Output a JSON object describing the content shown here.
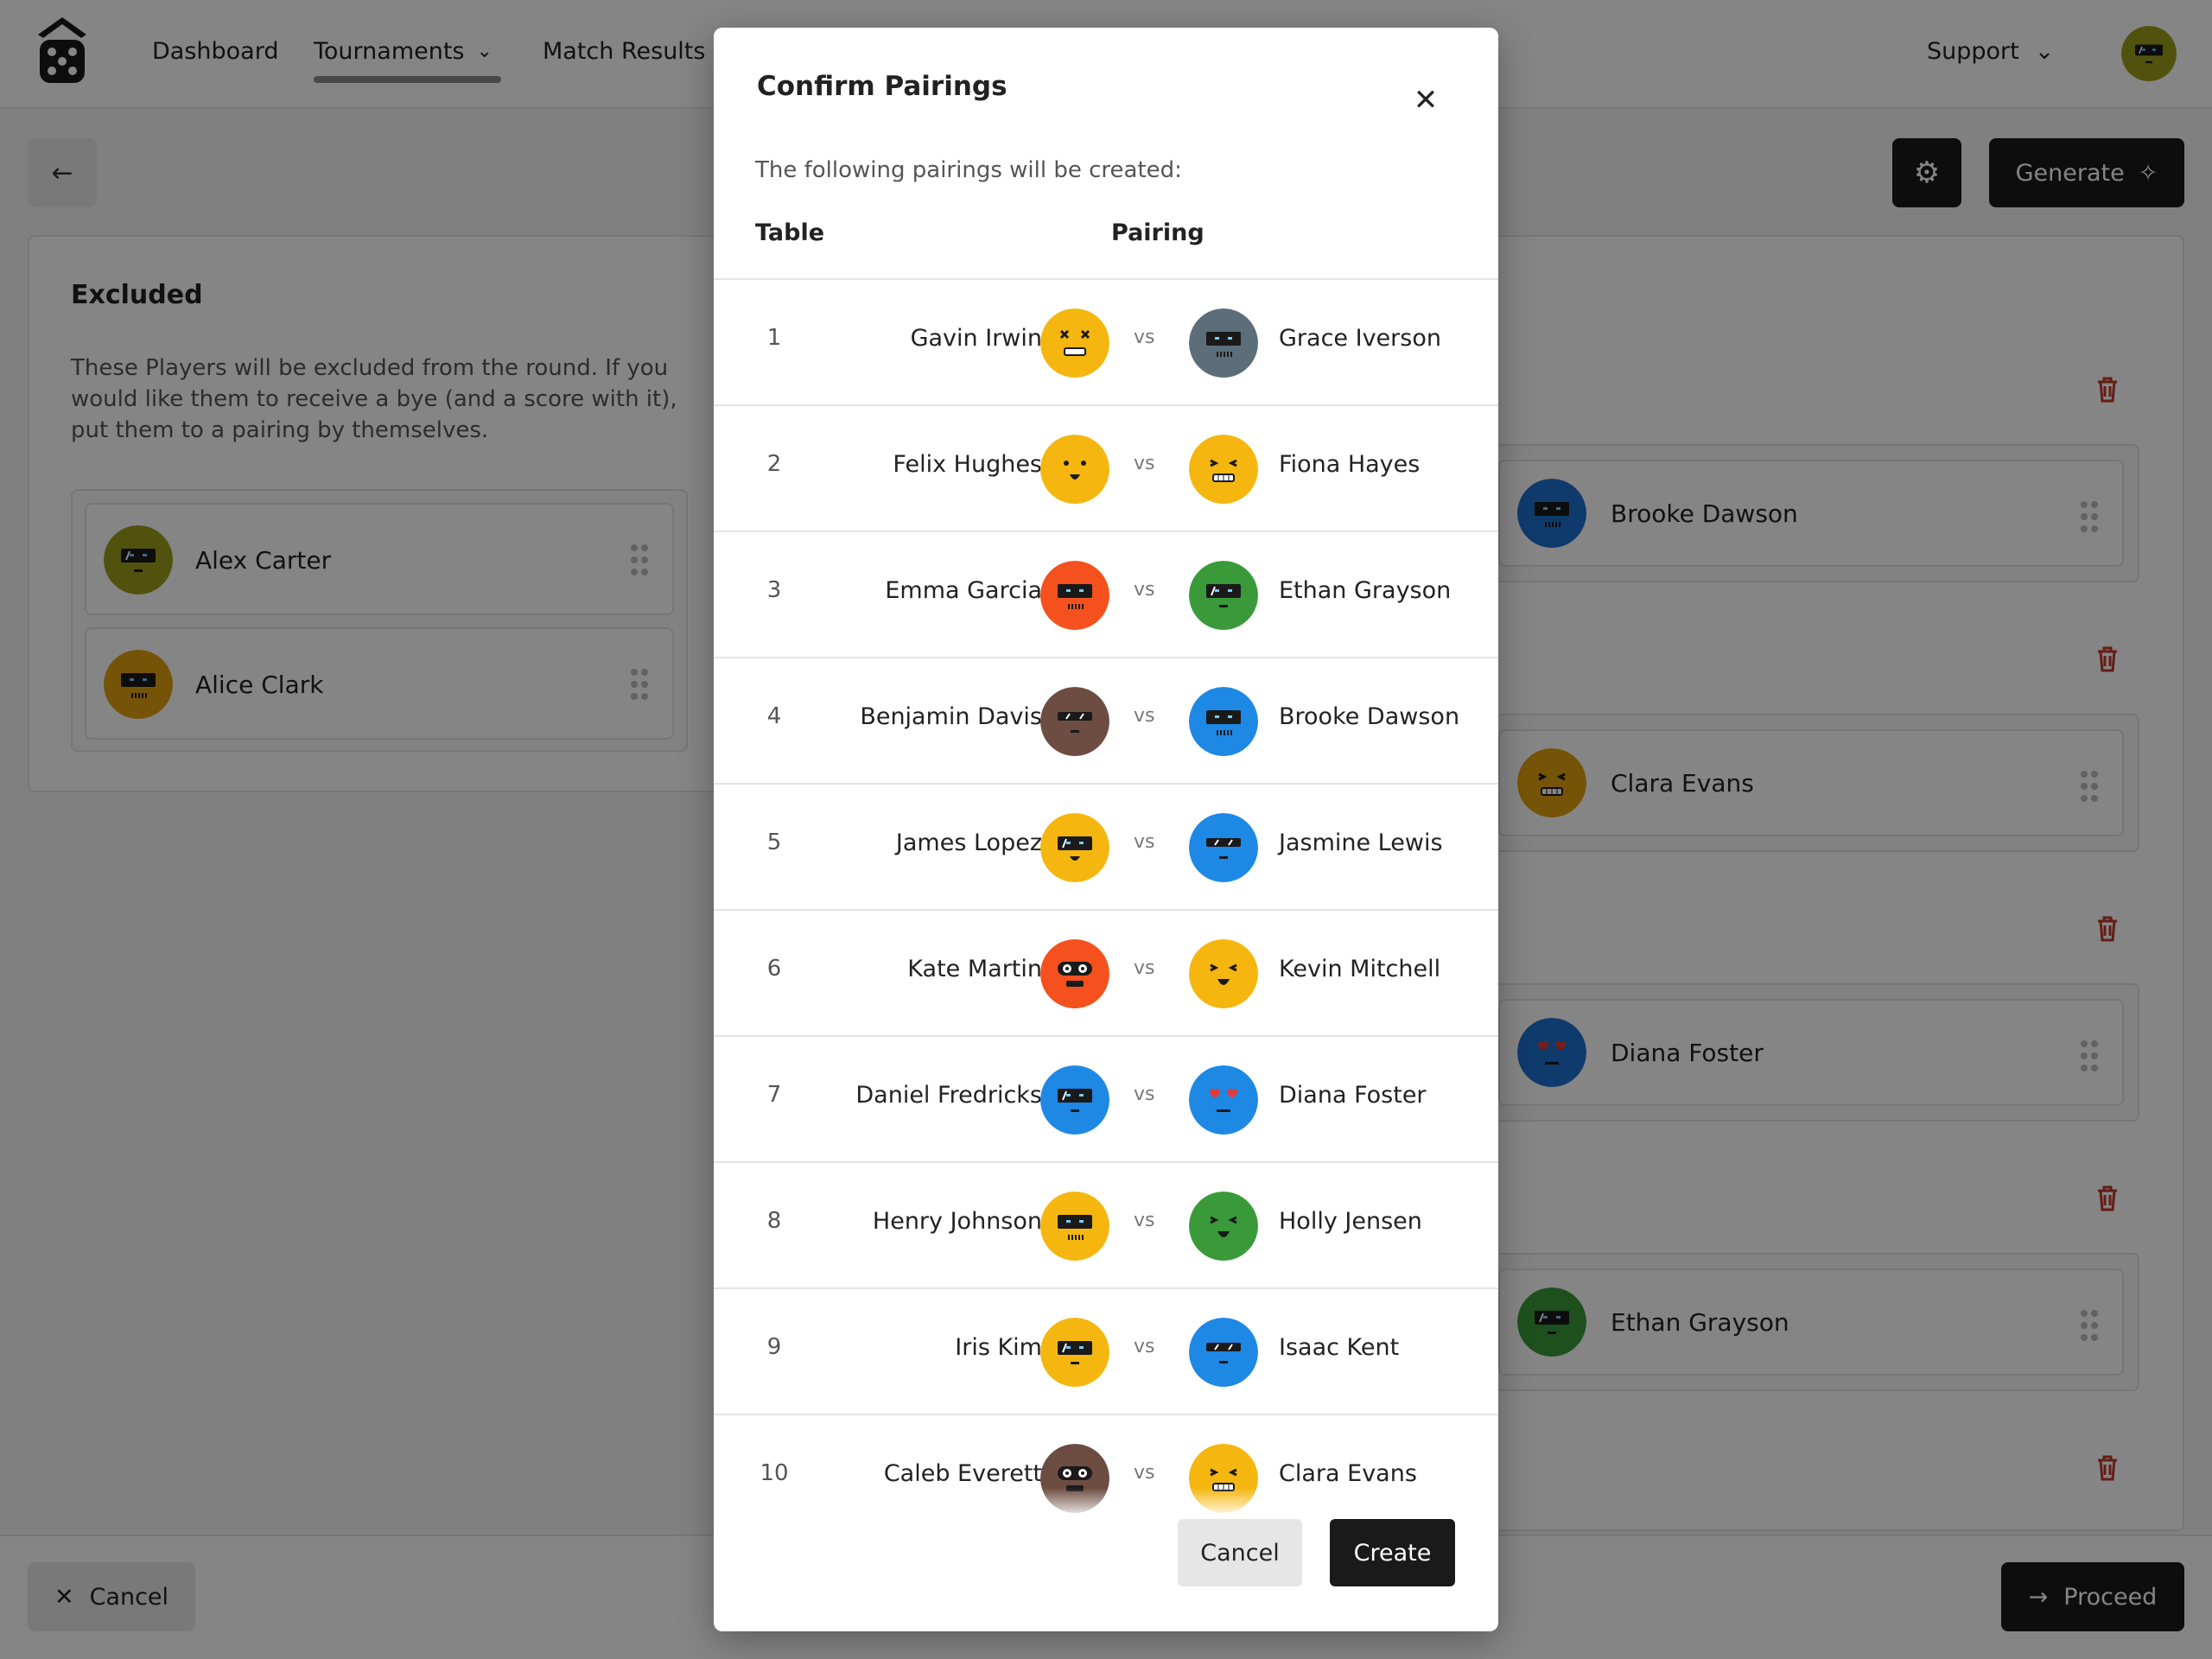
{
  "nav": {
    "items": [
      "Dashboard",
      "Tournaments",
      "Match Results"
    ],
    "active": "Tournaments",
    "support_label": "Support"
  },
  "header_avatar": {
    "color": "#9e9e1e",
    "face": "visor"
  },
  "page": {
    "generate_label": "Generate",
    "cancel_label": "Cancel",
    "proceed_label": "Proceed"
  },
  "excluded": {
    "title": "Excluded",
    "description": "These Players will be excluded from the round. If you would like them to receive a bye (and a score with it), put them to a pairing by themselves.",
    "players": [
      {
        "name": "Alex Carter",
        "color": "#9e9e1e",
        "face": "visor"
      },
      {
        "name": "Alice Clark",
        "color": "#e3a20e",
        "face": "visor-teeth"
      }
    ]
  },
  "pairing_slots": [
    {
      "name": "Brooke Dawson",
      "color": "#1e6fd0",
      "face": "visor-teeth"
    },
    {
      "name": "Clara Evans",
      "color": "#e3a20e",
      "face": "squint-teeth"
    },
    {
      "name": "Diana Foster",
      "color": "#1e6fd0",
      "face": "hearts"
    },
    {
      "name": "Ethan Grayson",
      "color": "#3a9a3a",
      "face": "visor"
    }
  ],
  "modal": {
    "title": "Confirm Pairings",
    "subtitle": "The following pairings will be created:",
    "col_table": "Table",
    "col_pairing": "Pairing",
    "vs_label": "vs",
    "cancel_label": "Cancel",
    "create_label": "Create",
    "rows": [
      {
        "table": "1",
        "p1": "Gavin Irwin",
        "c1": "#f5b70f",
        "f1": "x-eyes",
        "p2": "Grace Iverson",
        "c2": "#5b6e7a",
        "f2": "visor-teeth"
      },
      {
        "table": "2",
        "p1": "Felix Hughes",
        "c1": "#f5b70f",
        "f2": "squint-teeth",
        "f1": "dots-smile",
        "p2": "Fiona Hayes",
        "c2": "#f5b70f"
      },
      {
        "table": "3",
        "p1": "Emma Garcia",
        "c1": "#f4511e",
        "f1": "visor-teeth",
        "p2": "Ethan Grayson",
        "c2": "#3a9a3a",
        "f2": "visor"
      },
      {
        "table": "4",
        "p1": "Benjamin Davis",
        "c1": "#6d4c41",
        "f1": "shades",
        "p2": "Brooke Dawson",
        "c2": "#1e88e5",
        "f2": "visor-teeth"
      },
      {
        "table": "5",
        "p1": "James Lopez",
        "c1": "#f5b70f",
        "f1": "visor-smile",
        "p2": "Jasmine Lewis",
        "c2": "#1e88e5",
        "f2": "shades"
      },
      {
        "table": "6",
        "p1": "Kate Martin",
        "c1": "#f4511e",
        "f1": "goggles",
        "p2": "Kevin Mitchell",
        "c2": "#f5b70f",
        "f2": "squint-smile"
      },
      {
        "table": "7",
        "p1": "Daniel Fredricks",
        "c1": "#1e88e5",
        "f1": "visor",
        "p2": "Diana Foster",
        "c2": "#1e88e5",
        "f2": "hearts"
      },
      {
        "table": "8",
        "p1": "Henry Johnson",
        "c1": "#f5b70f",
        "f1": "visor-teeth",
        "p2": "Holly Jensen",
        "c2": "#3a9a3a",
        "f2": "squint-smile"
      },
      {
        "table": "9",
        "p1": "Iris Kim",
        "c1": "#f5b70f",
        "f1": "visor",
        "p2": "Isaac Kent",
        "c2": "#1e88e5",
        "f2": "shades"
      },
      {
        "table": "10",
        "p1": "Caleb Everett",
        "c1": "#6d4c41",
        "f1": "goggles",
        "p2": "Clara Evans",
        "c2": "#f5b70f",
        "f2": "squint-teeth"
      }
    ]
  }
}
